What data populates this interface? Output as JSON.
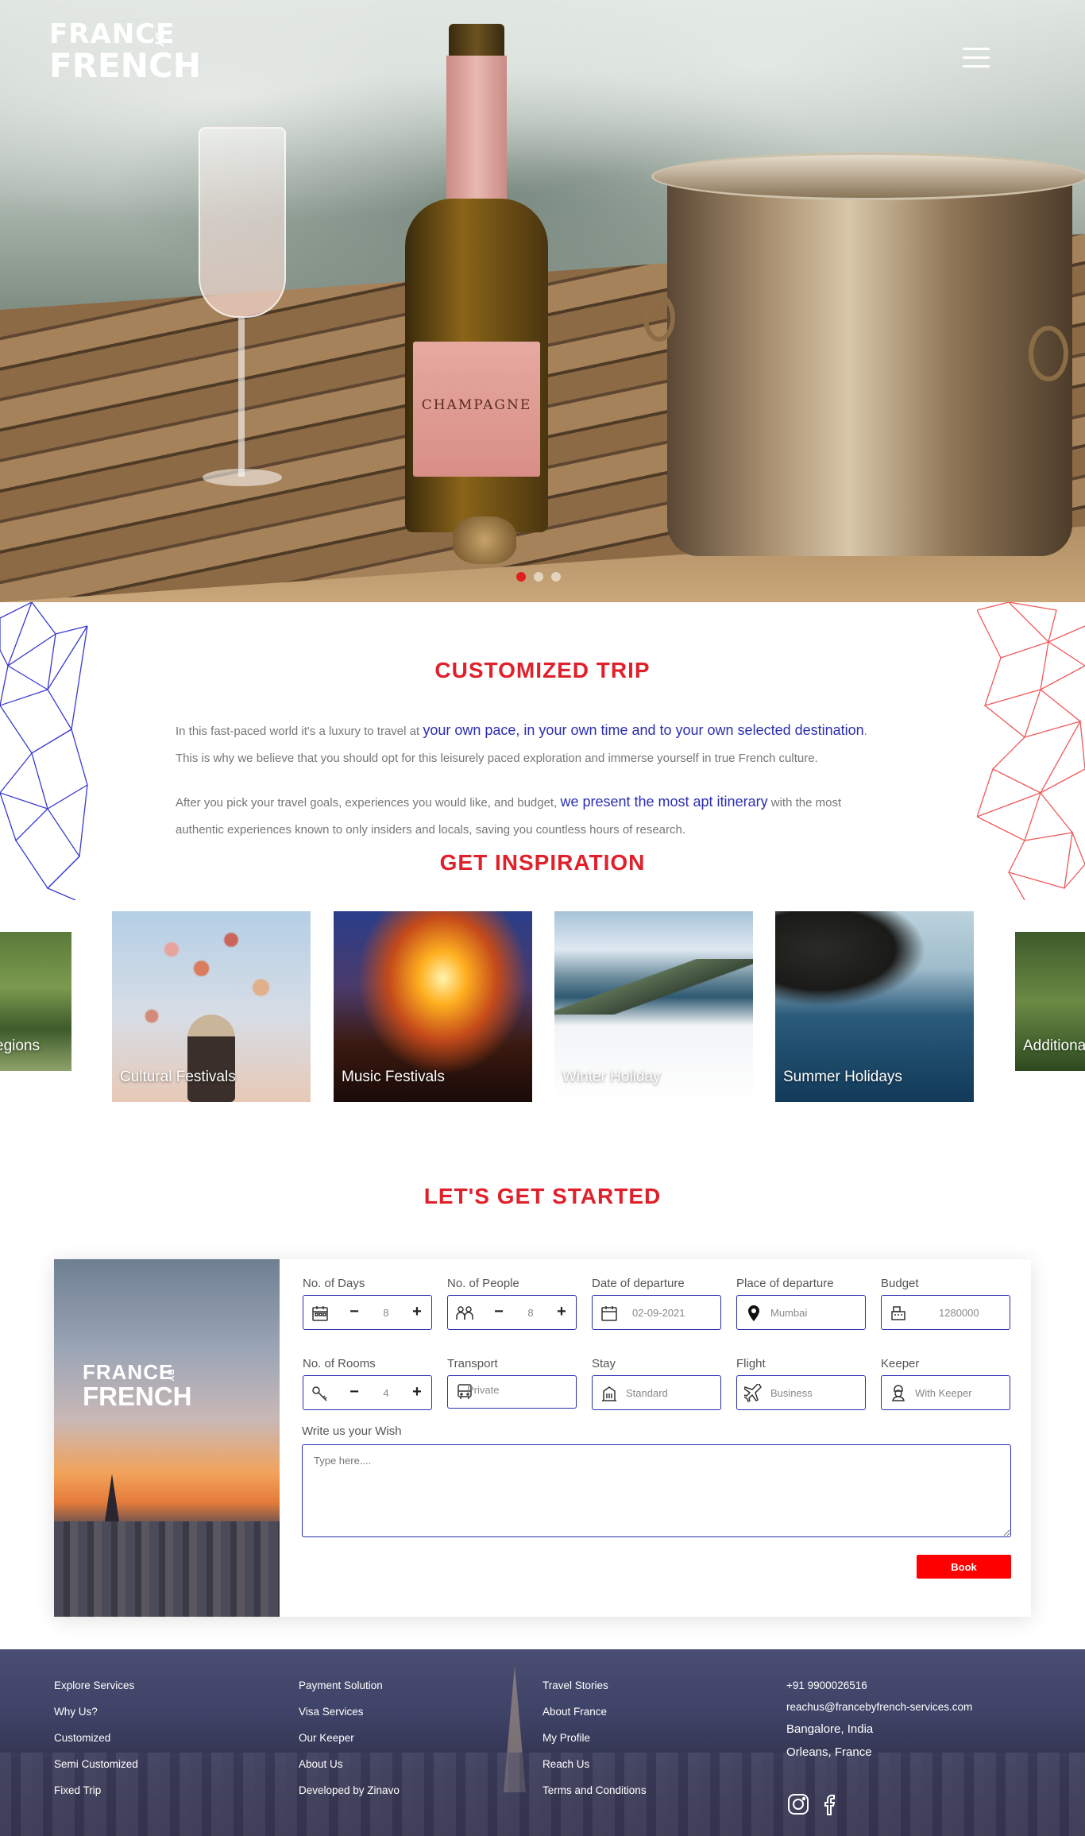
{
  "brand": {
    "logo_line1": "FRANCE",
    "logo_line2": "FRENCH",
    "logo_by": "BY"
  },
  "hero": {
    "bottle_label": "CHAMPAGNE",
    "slide_count": 3
  },
  "customized": {
    "title": "CUSTOMIZED TRIP",
    "p1_a": "In this fast-paced world it's a luxury to travel at ",
    "p1_hl": "your own pace, in your own time and to your own selected destination",
    "p1_b": ".",
    "p1_c": "This is why we believe that you should opt for this leisurely paced exploration and immerse yourself in true French culture.",
    "p2_a": "After you pick your travel goals, experiences you would like, and budget, ",
    "p2_hl": "we present the most apt itinerary",
    "p2_b": " with the most",
    "p2_c": "authentic experiences known to only insiders and locals, saving you countless hours of research."
  },
  "inspiration": {
    "title": "GET INSPIRATION",
    "cards": [
      {
        "label": "egions"
      },
      {
        "label": "Cultural Festivals"
      },
      {
        "label": "Music Festivals"
      },
      {
        "label": "Winter Holiday"
      },
      {
        "label": "Summer Holidays"
      },
      {
        "label": "Additiona"
      }
    ]
  },
  "started": {
    "title": "LET'S GET STARTED",
    "image_logo_a": "FRANCE",
    "image_logo_b": "FRENCH",
    "image_logo_by": "BY",
    "fields": {
      "days": {
        "label": "No. of Days",
        "value": "8"
      },
      "people": {
        "label": "No. of People",
        "value": "8"
      },
      "departure_date": {
        "label": "Date of departure",
        "value": "02-09-2021"
      },
      "departure_place": {
        "label": "Place of departure",
        "value": "Mumbai"
      },
      "budget": {
        "label": "Budget",
        "value": "1280000"
      },
      "rooms": {
        "label": "No. of Rooms",
        "value": "4"
      },
      "transport": {
        "label": "Transport",
        "value": "Private"
      },
      "stay": {
        "label": "Stay",
        "value": "Standard"
      },
      "flight": {
        "label": "Flight",
        "value": "Business"
      },
      "keeper": {
        "label": "Keeper",
        "value": "With Keeper"
      }
    },
    "minus": "−",
    "plus": "+",
    "wish_label": "Write us your Wish",
    "wish_placeholder": "Type here....",
    "book_label": "Book"
  },
  "footer": {
    "col1": [
      "Explore Services",
      "Why Us?",
      "Customized",
      "Semi Customized",
      "Fixed Trip"
    ],
    "col2": [
      "Payment Solution",
      "Visa Services",
      "Our Keeper",
      "About Us",
      "Developed by Zinavo"
    ],
    "col3": [
      "Travel Stories",
      "About France",
      "My Profile",
      "Reach Us",
      "Terms and Conditions"
    ],
    "phone": "+91 9900026516",
    "email": "reachus@francebyfrench-services.com",
    "city1": "Bangalore, India",
    "city2": "Orleans, France"
  },
  "colors": {
    "accent_red": "#e0202a",
    "accent_blue": "#2b2eb0",
    "book_red": "#ff0000"
  },
  "icons": [
    "calendar-icon",
    "people-icon",
    "location-pin-icon",
    "cash-register-icon",
    "key-icon",
    "bus-icon",
    "building-icon",
    "airplane-icon",
    "keeper-icon",
    "instagram-icon",
    "facebook-icon",
    "hamburger-menu-icon"
  ]
}
